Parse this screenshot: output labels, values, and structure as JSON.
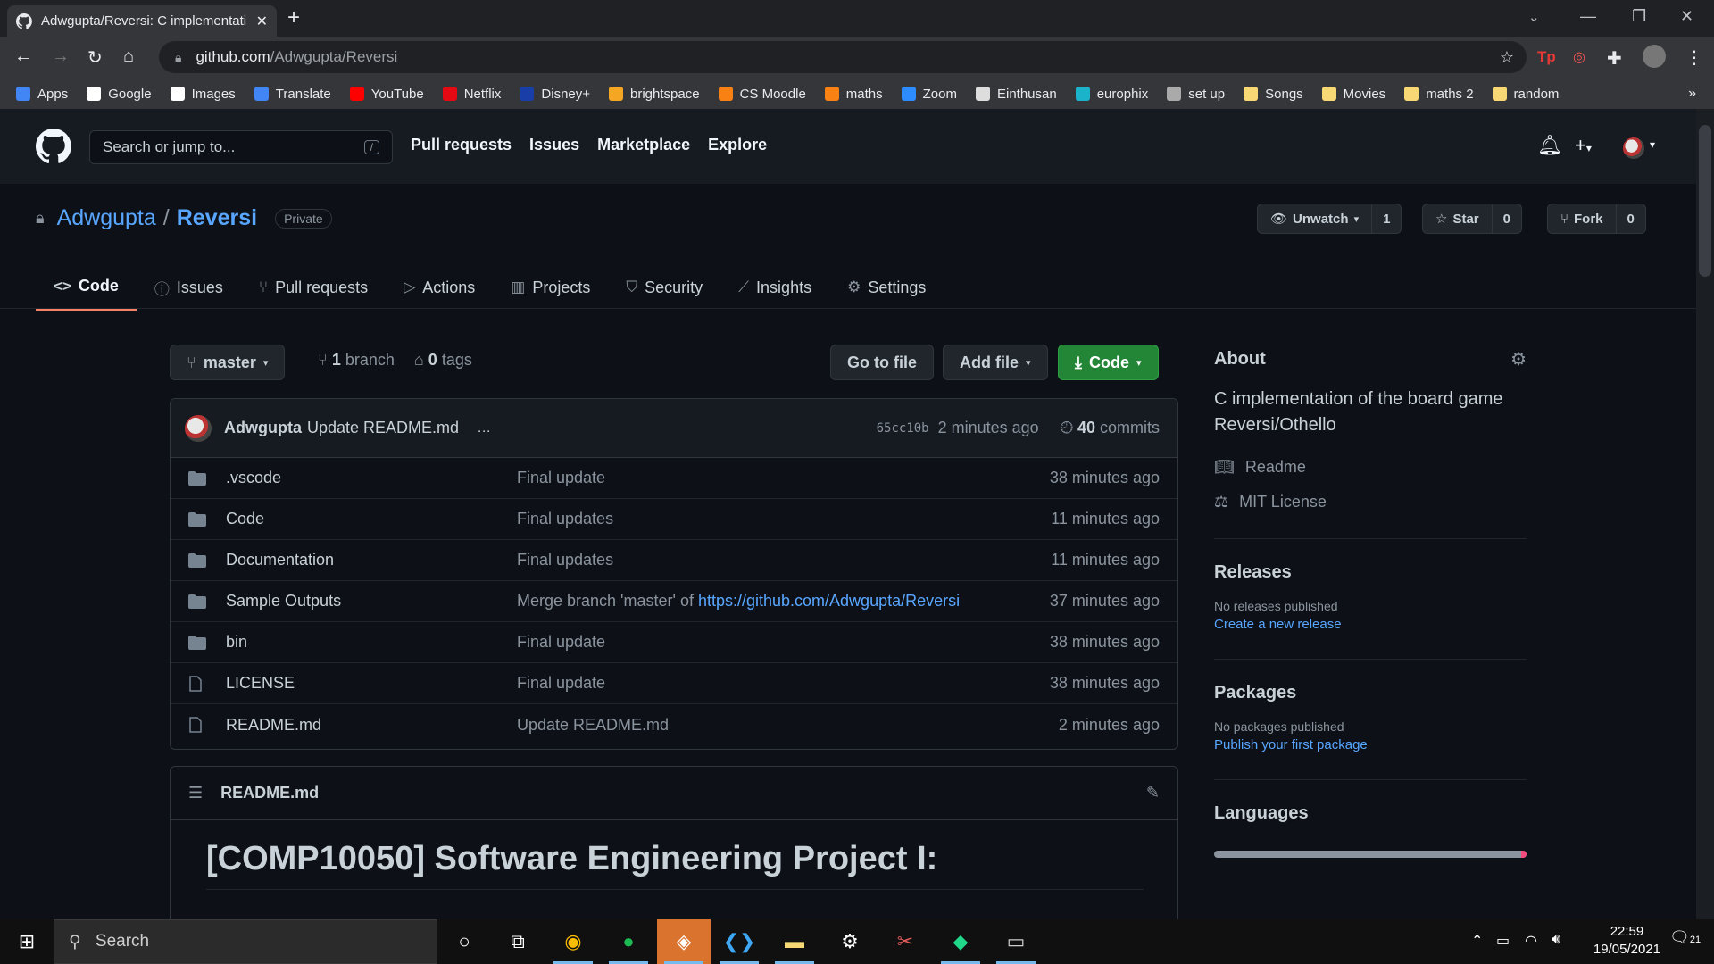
{
  "browser": {
    "tab_title": "Adwgupta/Reversi: C implementati",
    "url_host": "github.com",
    "url_path": "/Adwgupta/Reversi",
    "bookmarks": [
      {
        "label": "Apps",
        "color": "#4285f4"
      },
      {
        "label": "Google",
        "color": "#ffffff"
      },
      {
        "label": "Images",
        "color": "#ffffff"
      },
      {
        "label": "Translate",
        "color": "#4285f4"
      },
      {
        "label": "YouTube",
        "color": "#ff0000"
      },
      {
        "label": "Netflix",
        "color": "#e50914"
      },
      {
        "label": "Disney+",
        "color": "#1a3ea8"
      },
      {
        "label": "brightspace",
        "color": "#f5a623"
      },
      {
        "label": "CS Moodle",
        "color": "#f98012"
      },
      {
        "label": "maths",
        "color": "#f98012"
      },
      {
        "label": "Zoom",
        "color": "#2d8cff"
      },
      {
        "label": "Einthusan",
        "color": "#dddddd"
      },
      {
        "label": "europhix",
        "color": "#1ab3c9"
      },
      {
        "label": "set up",
        "color": "#aaaaaa"
      },
      {
        "label": "Songs",
        "color": "#f8d775"
      },
      {
        "label": "Movies",
        "color": "#f8d775"
      },
      {
        "label": "maths 2",
        "color": "#f8d775"
      },
      {
        "label": "random",
        "color": "#f8d775"
      }
    ],
    "more": "»"
  },
  "gh_header": {
    "search_placeholder": "Search or jump to...",
    "search_key": "/",
    "nav": [
      "Pull requests",
      "Issues",
      "Marketplace",
      "Explore"
    ]
  },
  "repo": {
    "owner": "Adwgupta",
    "separator": "/",
    "name": "Reversi",
    "visibility": "Private",
    "watch": {
      "label": "Unwatch",
      "count": "1"
    },
    "star": {
      "label": "Star",
      "count": "0"
    },
    "fork": {
      "label": "Fork",
      "count": "0"
    },
    "tabs": [
      {
        "label": "Code",
        "icon": "<>"
      },
      {
        "label": "Issues",
        "icon": "ⓘ"
      },
      {
        "label": "Pull requests",
        "icon": "⑂"
      },
      {
        "label": "Actions",
        "icon": "▷"
      },
      {
        "label": "Projects",
        "icon": "▥"
      },
      {
        "label": "Security",
        "icon": "⛉"
      },
      {
        "label": "Insights",
        "icon": "⟋"
      },
      {
        "label": "Settings",
        "icon": "⚙"
      }
    ]
  },
  "code": {
    "branch": "master",
    "branch_count": "1",
    "branch_word": "branch",
    "tag_count": "0",
    "tag_word": "tags",
    "go_to_file": "Go to file",
    "add_file": "Add file",
    "code_btn": "Code",
    "commit": {
      "author": "Adwgupta",
      "message": "Update README.md",
      "ellipsis": "…",
      "sha": "65cc10b",
      "time": "2 minutes ago",
      "commit_count": "40",
      "commit_word": "commits"
    },
    "files": [
      {
        "name": ".vscode",
        "type": "dir",
        "msg": "Final update",
        "link": "",
        "time": "38 minutes ago"
      },
      {
        "name": "Code",
        "type": "dir",
        "msg": "Final updates",
        "link": "",
        "time": "11 minutes ago"
      },
      {
        "name": "Documentation",
        "type": "dir",
        "msg": "Final updates",
        "link": "",
        "time": "11 minutes ago"
      },
      {
        "name": "Sample Outputs",
        "type": "dir",
        "msg": "Merge branch 'master' of ",
        "link": "https://github.com/Adwgupta/Reversi",
        "time": "37 minutes ago"
      },
      {
        "name": "bin",
        "type": "dir",
        "msg": "Final update",
        "link": "",
        "time": "38 minutes ago"
      },
      {
        "name": "LICENSE",
        "type": "file",
        "msg": "Final update",
        "link": "",
        "time": "38 minutes ago"
      },
      {
        "name": "README.md",
        "type": "file",
        "msg": "Update README.md",
        "link": "",
        "time": "2 minutes ago"
      }
    ],
    "readme_file": "README.md",
    "readme_title": "[COMP10050] Software Engineering Project I:"
  },
  "sidebar": {
    "about_title": "About",
    "description": "C implementation of the board game Reversi/Othello",
    "readme_link": "Readme",
    "license_link": "MIT License",
    "releases_title": "Releases",
    "releases_none": "No releases published",
    "releases_create": "Create a new release",
    "packages_title": "Packages",
    "packages_none": "No packages published",
    "packages_publish": "Publish your first package",
    "languages_title": "Languages"
  },
  "taskbar": {
    "search_placeholder": "Search",
    "time": "22:59",
    "date": "19/05/2021",
    "notif_count": "21"
  },
  "colors": {
    "accent_tab": "#f78166",
    "link": "#58a6ff",
    "green_button": "#238636"
  }
}
